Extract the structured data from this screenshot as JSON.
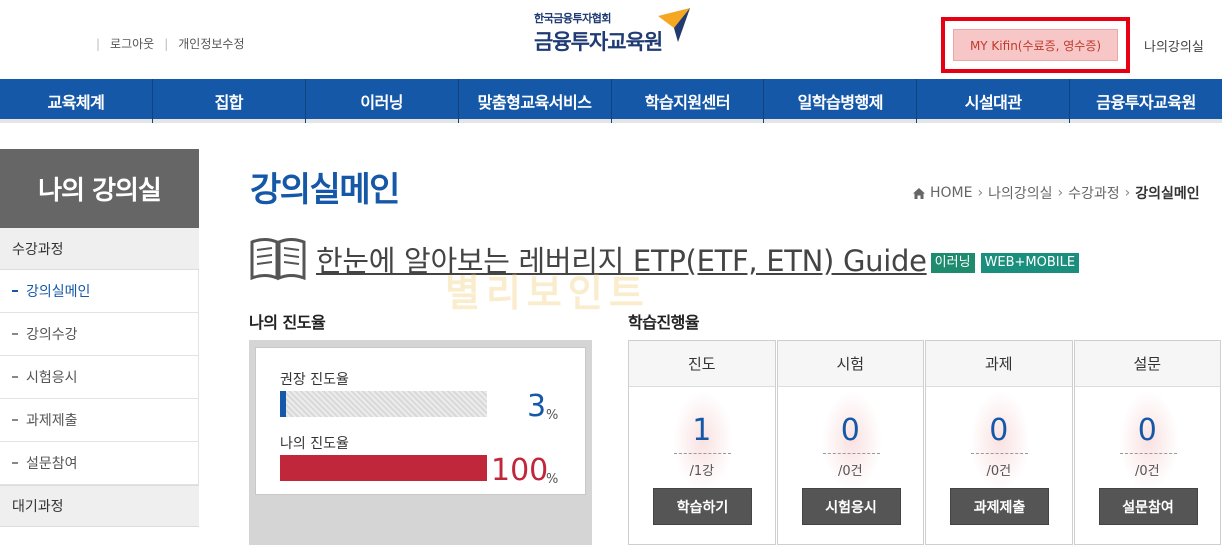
{
  "header": {
    "logout": "로그아웃",
    "edit_profile": "개인정보수정",
    "logo_org": "한국금융투자협회",
    "logo_name": "금융투자교육원",
    "my_kifin": "MY Kifin(수료증, 영수증)",
    "my_classroom": "나의강의실"
  },
  "gnb": [
    "교육체계",
    "집합",
    "이러닝",
    "맞춤형교육서비스",
    "학습지원센터",
    "일학습병행제",
    "시설대관",
    "금융투자교육원"
  ],
  "sidebar": {
    "title": "나의 강의실",
    "category1": "수강과정",
    "items": [
      "강의실메인",
      "강의수강",
      "시험응시",
      "과제제출",
      "설문참여"
    ],
    "category2": "대기과정"
  },
  "main": {
    "title": "강의실메인",
    "breadcrumb": [
      "HOME",
      "나의강의실",
      "수강과정",
      "강의실메인"
    ],
    "course_title": "한눈에 알아보는 레버리지 ETP(ETF, ETN) Guide",
    "badges": [
      "이러닝",
      "WEB+MOBILE"
    ],
    "watermark": "별리보인트"
  },
  "progress": {
    "label": "나의 진도율",
    "recommended_label": "권장 진도율",
    "recommended_value": "3",
    "recommended_fraction": 0.03,
    "my_label": "나의 진도율",
    "my_value": "100",
    "my_fraction": 1.0,
    "unit": "%"
  },
  "learning": {
    "label": "학습진행율",
    "cards": [
      {
        "head": "진도",
        "num": "1",
        "den": "/1강",
        "button": "학습하기"
      },
      {
        "head": "시험",
        "num": "0",
        "den": "/0건",
        "button": "시험응시"
      },
      {
        "head": "과제",
        "num": "0",
        "den": "/0건",
        "button": "과제제출"
      },
      {
        "head": "설문",
        "num": "0",
        "den": "/0건",
        "button": "설문참여"
      }
    ]
  },
  "colors": {
    "primary": "#1658a8",
    "progress_blue": "#1658a8",
    "progress_red": "#c0273a",
    "highlight": "#e60012"
  }
}
